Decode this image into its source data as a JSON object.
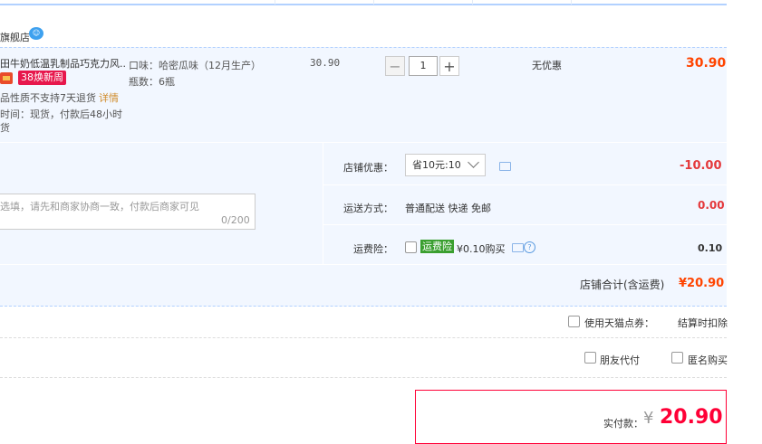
{
  "shop": {
    "name": "旗舰店"
  },
  "item": {
    "title": "田牛奶低温乳制品巧克力风...",
    "badge": "38焕新周",
    "notice": "品性质不支持7天退货",
    "notice_more": "详情",
    "ship_time_1": "时间：现货，付款后48小时",
    "ship_time_2": "货",
    "sku_flavor": "口味：哈密瓜味（12月生产）",
    "sku_count": "瓶数：6瓶",
    "price": "30.90",
    "quantity": "1",
    "discount": "无优惠",
    "subtotal": "30.90"
  },
  "order": {
    "memo_placeholder": "选填，请先和商家协商一致，付款后商家可见",
    "memo_count": "0/200",
    "coupon_label": "店铺优惠：",
    "coupon_selected": "省10元:10",
    "coupon_amount": "-10.00",
    "ship_label": "运送方式：",
    "ship_method": "普通配送 快递 免邮",
    "ship_fee": "0.00",
    "insurance_label": "运费险：",
    "insurance_badge": "运费险",
    "insurance_price": "¥0.10购买",
    "insurance_amount": "0.10",
    "total_label": "店铺合计(含运费)",
    "total_value": "¥20.90"
  },
  "options": {
    "points_label": "使用天猫点券：",
    "points_note": "结算时扣除",
    "friend_pay": "朋友代付",
    "anonymous": "匿名购买"
  },
  "payment": {
    "label": "实付款：",
    "currency": "¥",
    "value": "20.90"
  }
}
